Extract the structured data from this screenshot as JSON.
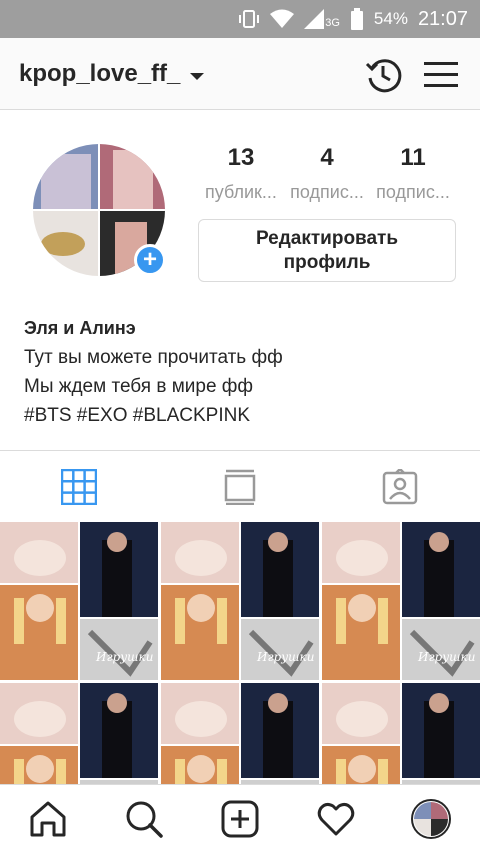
{
  "status_bar": {
    "network": "3G",
    "battery": "54%",
    "time": "21:07"
  },
  "header": {
    "username": "kpop_love_ff_",
    "icons": [
      "chevron-down-icon",
      "history-icon",
      "menu-icon"
    ]
  },
  "profile": {
    "stats": [
      {
        "value": "13",
        "label": "публик..."
      },
      {
        "value": "4",
        "label": "подпис..."
      },
      {
        "value": "11",
        "label": "подпис..."
      }
    ],
    "edit_button": "Редактировать профиль",
    "bio": {
      "name": "Эля и Алинэ",
      "line1": "Тут вы можете прочитать фф",
      "line2": "Мы ждем тебя в мире фф",
      "line3": "#BTS #EXO #BLACKPINK"
    }
  },
  "tabs": [
    "grid-icon",
    "feed-icon",
    "tagged-icon"
  ],
  "posts": {
    "watermark": "Игрушки"
  },
  "bottom_nav": [
    "home-icon",
    "search-icon",
    "add-post-icon",
    "activity-icon",
    "profile-avatar"
  ]
}
